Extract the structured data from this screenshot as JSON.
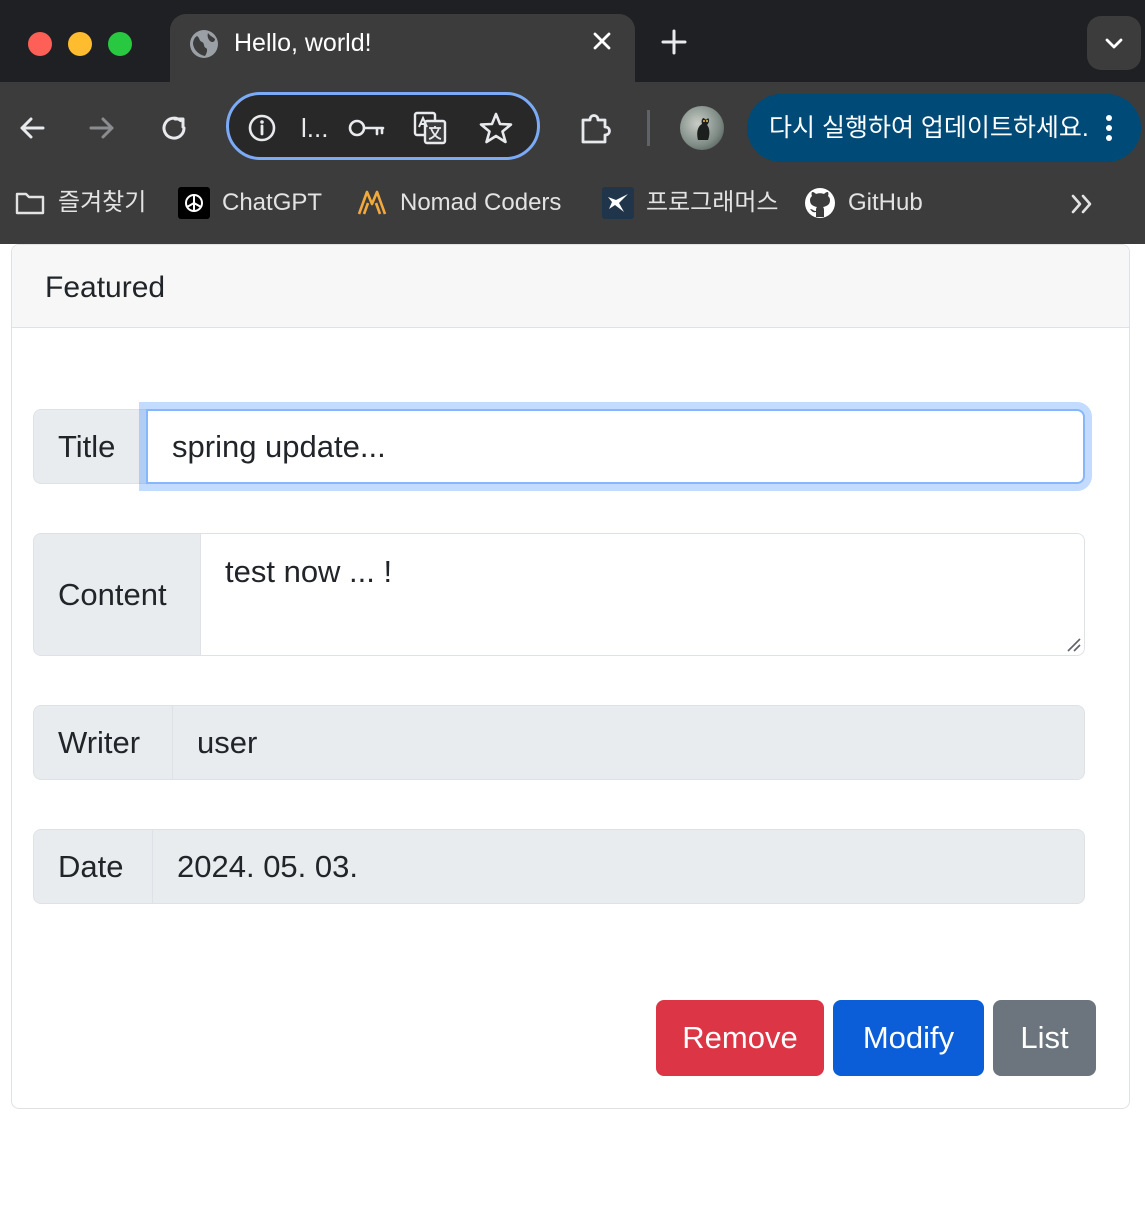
{
  "browser": {
    "tab": {
      "title": "Hello, world!"
    },
    "omnibox": {
      "url_text": "l..."
    },
    "update_button": {
      "label": "다시 실행하여 업데이트하세요."
    },
    "bookmarks": [
      {
        "label": "즐겨찾기",
        "icon": "folder-icon"
      },
      {
        "label": "ChatGPT",
        "icon": "chatgpt-icon"
      },
      {
        "label": "Nomad Coders",
        "icon": "nomad-coders-icon"
      },
      {
        "label": "프로그래머스",
        "icon": "programmers-icon"
      },
      {
        "label": "GitHub",
        "icon": "github-icon"
      }
    ],
    "colors": {
      "tabbar": "#1f2023",
      "toolbar": "#3c3c3c",
      "update_pill": "#004a77",
      "focus_ring": "#7baaf7"
    }
  },
  "page": {
    "card_header": "Featured",
    "form": {
      "title": {
        "label": "Title",
        "value": "spring update..."
      },
      "content": {
        "label": "Content",
        "value": "test now ... !"
      },
      "writer": {
        "label": "Writer",
        "value": "user"
      },
      "date": {
        "label": "Date",
        "value": "2024. 05. 03."
      }
    },
    "buttons": {
      "remove": "Remove",
      "modify": "Modify",
      "list": "List"
    },
    "colors": {
      "remove": "#dc3545",
      "modify": "#0b5ed7",
      "list": "#6c757d"
    }
  }
}
